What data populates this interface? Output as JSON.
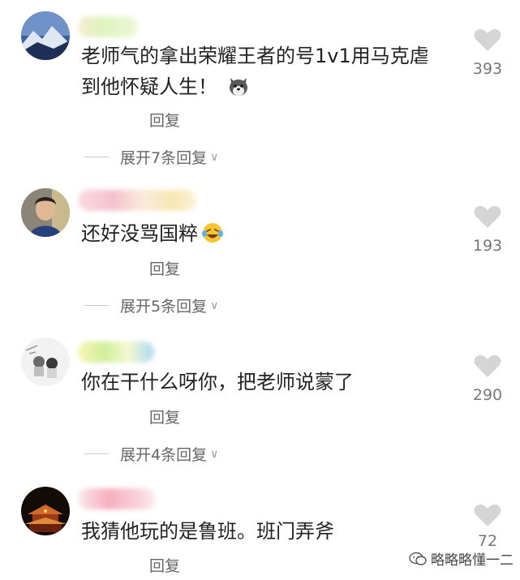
{
  "comments": [
    {
      "text_line1": "老师气的拿出荣耀王者的号1v1用马克虐",
      "text_line2": "到他怀疑人生！",
      "emoji": "husky-dog-emoji",
      "reply_label": "回复",
      "expand_label": "展开7条回复",
      "likes": "393"
    },
    {
      "text_line1": "还好没骂国粹",
      "emoji": "laughing-tears-emoji",
      "reply_label": "回复",
      "expand_label": "展开5条回复",
      "likes": "193"
    },
    {
      "text_line1": "你在干什么呀你，把老师说蒙了",
      "reply_label": "回复",
      "expand_label": "展开4条回复",
      "likes": "290"
    },
    {
      "text_line1": "我猜他玩的是鲁班。班门弄斧",
      "reply_label": "回复",
      "likes": "72"
    }
  ],
  "watermark": "略略略懂一二",
  "icons": {
    "like": "heart-icon",
    "chevron": "chevron-down-icon",
    "watermark": "wechat-icon"
  },
  "colors": {
    "text": "#222222",
    "secondary": "#666666",
    "heart": "#d5d5d5"
  }
}
